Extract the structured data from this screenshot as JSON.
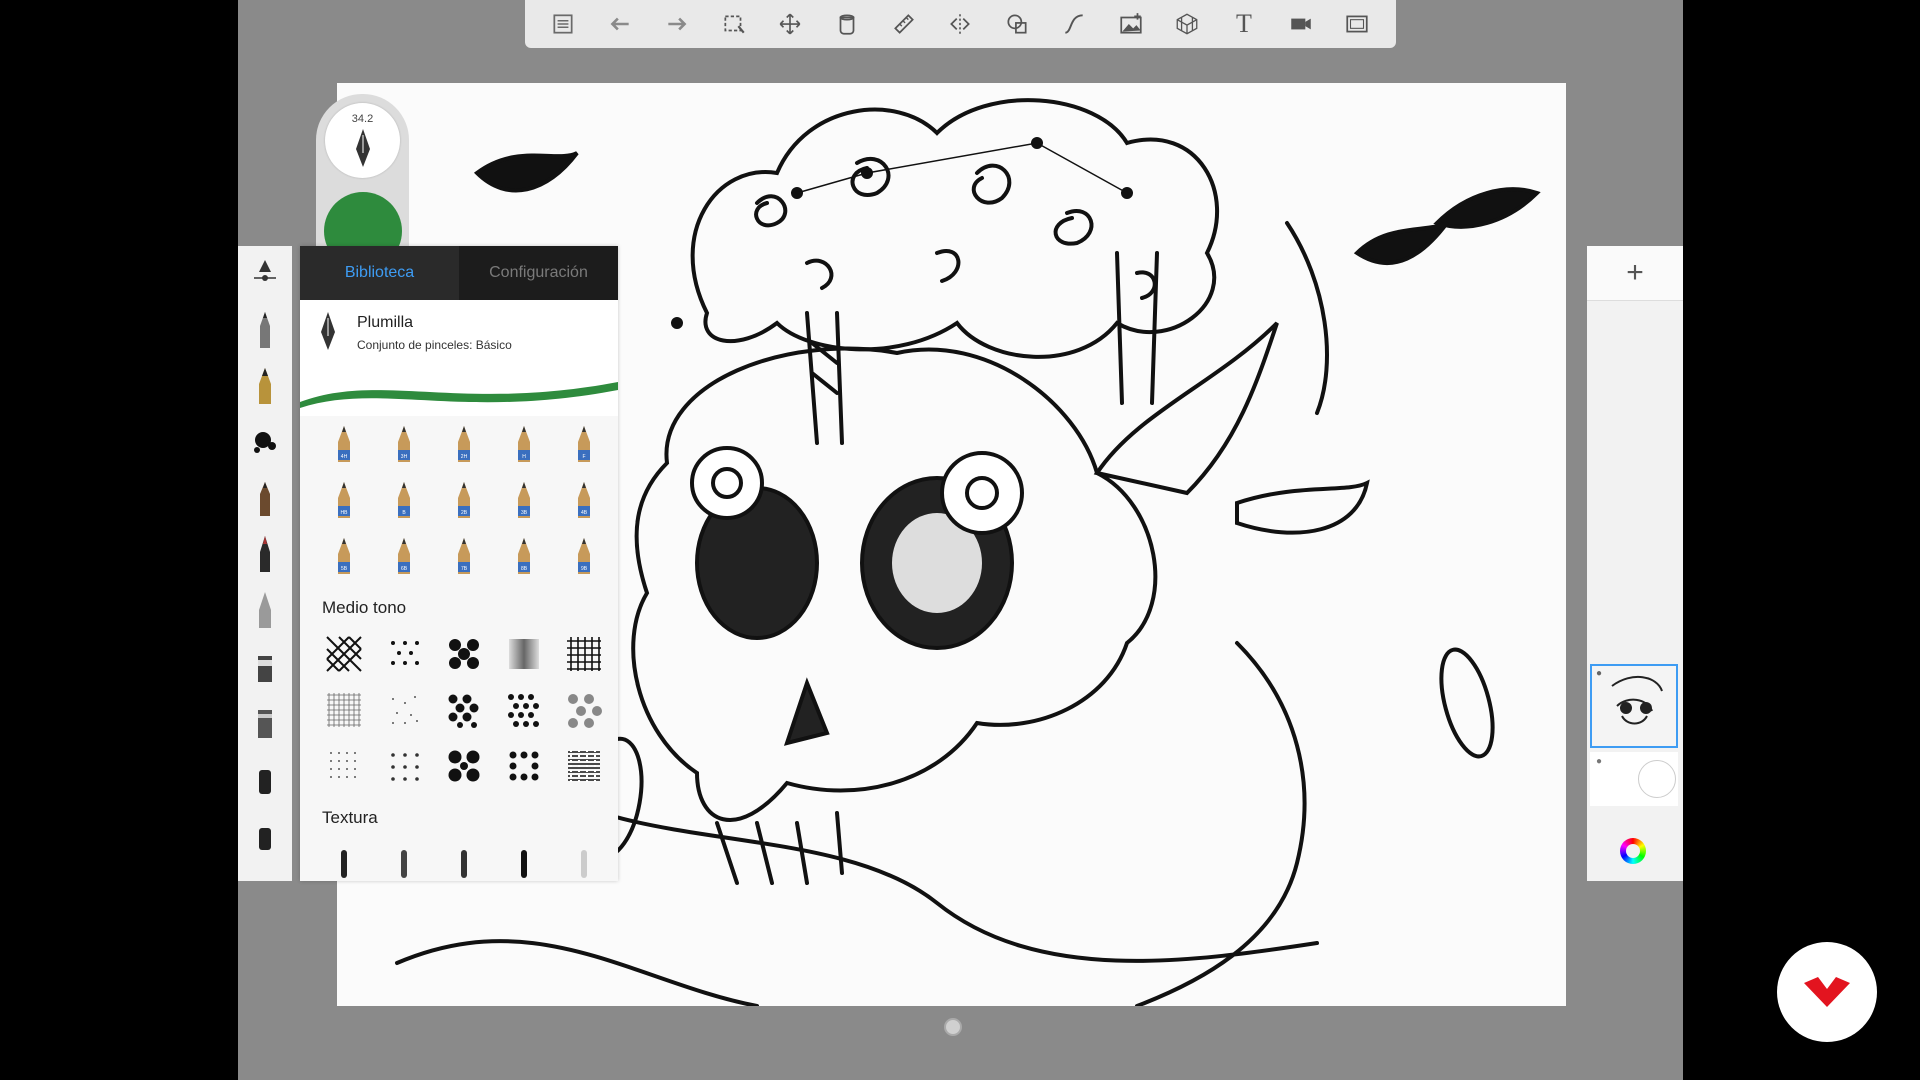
{
  "toolbar": {
    "icons": [
      "list-icon",
      "undo-icon",
      "redo-icon",
      "selection-icon",
      "transform-icon",
      "fill-icon",
      "ruler-icon",
      "symmetry-icon",
      "shapes-icon",
      "curve-icon",
      "image-icon",
      "perspective-icon",
      "text-icon",
      "record-icon",
      "fullscreen-icon"
    ],
    "text_tool_glyph": "T"
  },
  "brush_size": {
    "value": "34.2"
  },
  "current_color": "#2e8b3d",
  "brush_panel": {
    "tabs": {
      "library": "Biblioteca",
      "settings": "Configuración"
    },
    "active_tab": "library",
    "brush_name": "Plumilla",
    "brush_set": "Conjunto de pinceles: Básico",
    "pencil_grades": [
      "4H",
      "3H",
      "2H",
      "H",
      "F",
      "HB",
      "B",
      "2B",
      "3B",
      "4B",
      "5B",
      "6B",
      "7B",
      "8B",
      "9B"
    ],
    "section_halftone": "Medio tono",
    "section_texture": "Textura",
    "halftone_patterns": [
      "crosshatch",
      "stars",
      "dots-large",
      "gradient-blur",
      "grid",
      "fine-grid",
      "sparse-dots",
      "big-dots",
      "medium-dots",
      "soft-dots",
      "tiny-dots",
      "small-dots",
      "bold-dots",
      "dense-dots",
      "noise"
    ],
    "texture_count": 5
  },
  "left_strip": {
    "tool_count": 11
  },
  "layers": {
    "add_label": "+",
    "count": 2
  },
  "colors": {
    "accent": "#3e9cf3",
    "panel_dark": "#1c1c1c",
    "brand_red": "#e3141f"
  }
}
